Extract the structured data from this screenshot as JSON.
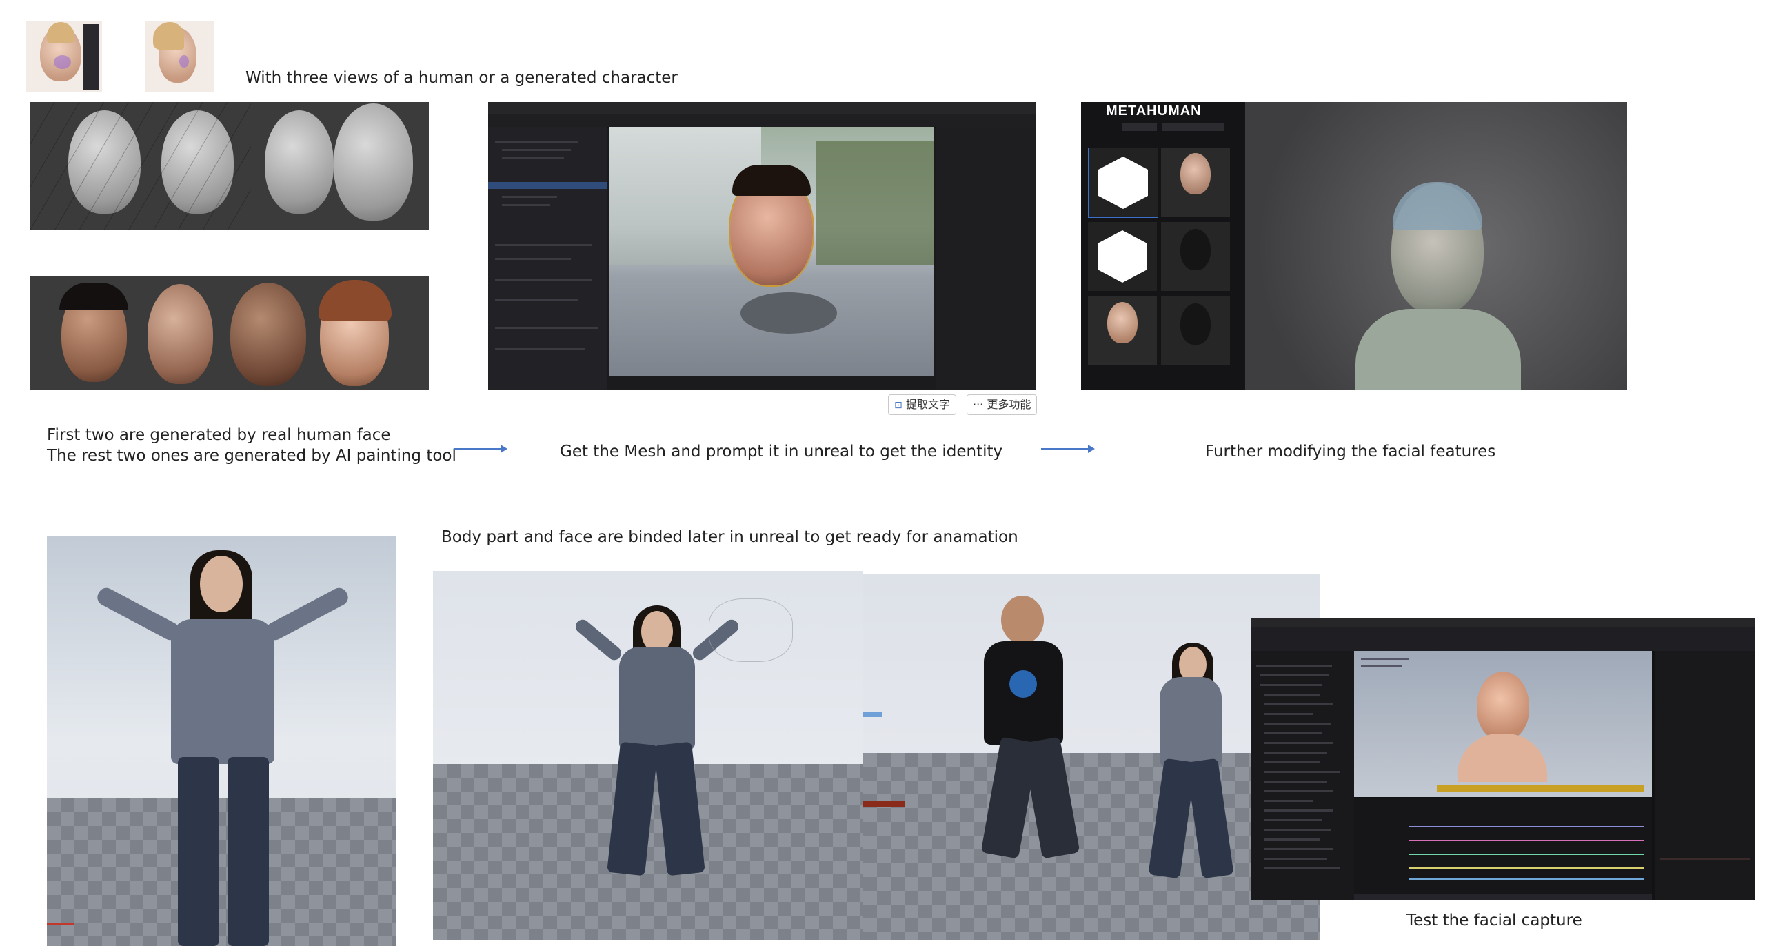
{
  "captions": {
    "three_views": "With three views of a human or a generated character",
    "real_vs_ai_line1": "First two are generated by real human face",
    "real_vs_ai_line2": "The rest two ones are generated by AI painting tool",
    "mesh_to_unreal": "Get the Mesh and prompt it in unreal to get the identity",
    "modify_features": "Further modifying the facial features",
    "body_binding": "Body part and face are binded later in unreal to get ready for anamation",
    "facial_capture": "Test the facial capture"
  },
  "screenshot_toolbar": {
    "extract_text": "提取文字",
    "more_features": "更多功能"
  },
  "metahuman_panel": {
    "brand": "METAHUMAN"
  },
  "colors": {
    "arrow": "#4a78c8",
    "ue_dark": "#1b1b1d",
    "panel_gray": "#3b3b3b"
  }
}
